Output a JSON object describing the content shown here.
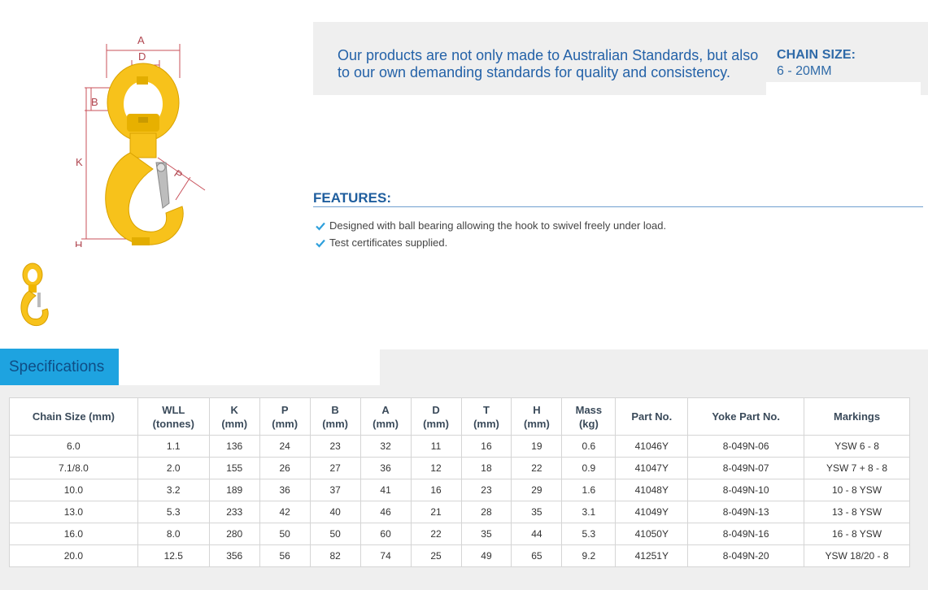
{
  "diagram": {
    "labels": {
      "a": "A",
      "d": "D",
      "b": "B",
      "k": "K",
      "p": "P",
      "h": "H"
    }
  },
  "intro": {
    "text": "Our products are not only made to Australian Standards, but also to our own demanding standards for quality and consistency."
  },
  "chain_size": {
    "label": "CHAIN SIZE:",
    "value": "6 - 20MM"
  },
  "features": {
    "title": "FEATURES:",
    "items": [
      "Designed with ball bearing allowing the hook to swivel freely under load.",
      "Test certificates supplied."
    ]
  },
  "specifications": {
    "tab_label": "Specifications",
    "columns": [
      {
        "line1": "Chain Size (mm)",
        "line2": ""
      },
      {
        "line1": "WLL",
        "line2": "(tonnes)"
      },
      {
        "line1": "K",
        "line2": "(mm)"
      },
      {
        "line1": "P",
        "line2": "(mm)"
      },
      {
        "line1": "B",
        "line2": "(mm)"
      },
      {
        "line1": "A",
        "line2": "(mm)"
      },
      {
        "line1": "D",
        "line2": "(mm)"
      },
      {
        "line1": "T",
        "line2": "(mm)"
      },
      {
        "line1": "H",
        "line2": "(mm)"
      },
      {
        "line1": "Mass",
        "line2": "(kg)"
      },
      {
        "line1": "Part No.",
        "line2": ""
      },
      {
        "line1": "Yoke Part No.",
        "line2": ""
      },
      {
        "line1": "Markings",
        "line2": ""
      }
    ],
    "rows": [
      [
        "6.0",
        "1.1",
        "136",
        "24",
        "23",
        "32",
        "11",
        "16",
        "19",
        "0.6",
        "41046Y",
        "8-049N-06",
        "YSW 6 - 8"
      ],
      [
        "7.1/8.0",
        "2.0",
        "155",
        "26",
        "27",
        "36",
        "12",
        "18",
        "22",
        "0.9",
        "41047Y",
        "8-049N-07",
        "YSW 7 + 8 - 8"
      ],
      [
        "10.0",
        "3.2",
        "189",
        "36",
        "37",
        "41",
        "16",
        "23",
        "29",
        "1.6",
        "41048Y",
        "8-049N-10",
        "10 - 8 YSW"
      ],
      [
        "13.0",
        "5.3",
        "233",
        "42",
        "40",
        "46",
        "21",
        "28",
        "35",
        "3.1",
        "41049Y",
        "8-049N-13",
        "13 - 8 YSW"
      ],
      [
        "16.0",
        "8.0",
        "280",
        "50",
        "50",
        "60",
        "22",
        "35",
        "44",
        "5.3",
        "41050Y",
        "8-049N-16",
        "16 - 8 YSW"
      ],
      [
        "20.0",
        "12.5",
        "356",
        "56",
        "82",
        "74",
        "25",
        "49",
        "65",
        "9.2",
        "41251Y",
        "8-049N-20",
        "YSW 18/20 - 8"
      ]
    ]
  },
  "colors": {
    "accent_blue": "#1ea3e0",
    "heading_blue": "#1f5e9e",
    "hook_yellow": "#f7c21b"
  }
}
